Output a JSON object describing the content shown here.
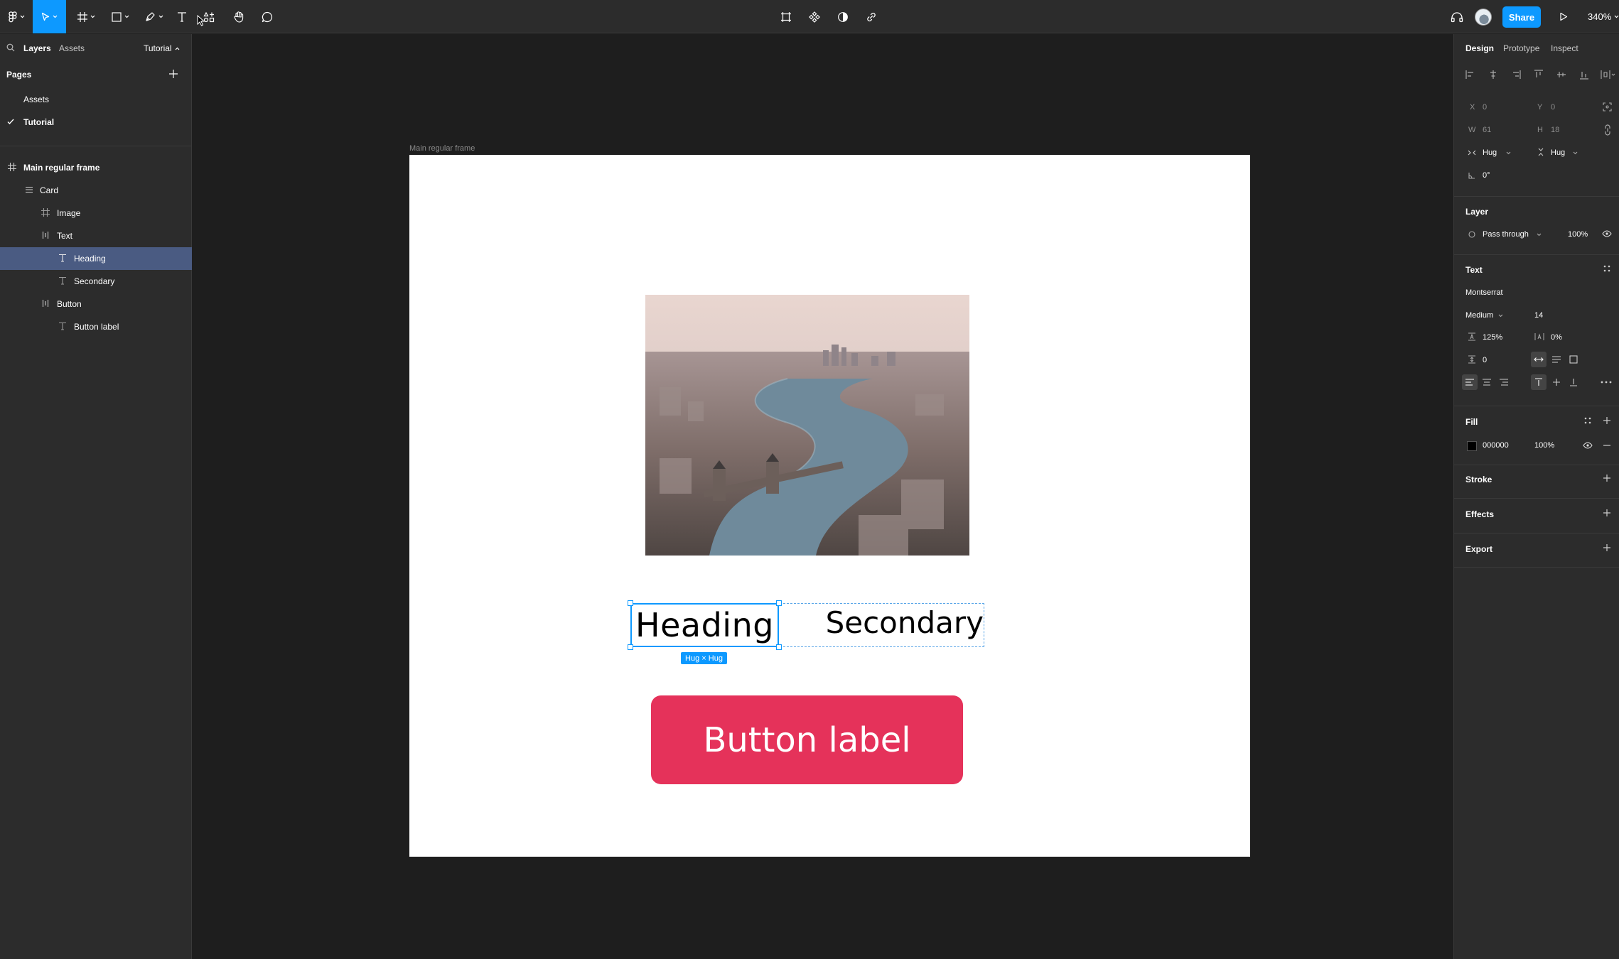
{
  "toolbar": {
    "share_label": "Share",
    "zoom": "340%",
    "icons": [
      "figma-menu-icon",
      "move-tool-icon",
      "frame-tool-icon",
      "shape-tool-icon",
      "pen-tool-icon",
      "text-tool-icon",
      "resources-icon",
      "hand-tool-icon",
      "comment-icon",
      "crop-icon",
      "component-icon",
      "contrast-icon",
      "link-icon",
      "headphones-icon",
      "play-icon"
    ]
  },
  "left_panel": {
    "tabs": {
      "layers": "Layers",
      "assets": "Assets"
    },
    "page_dropdown": "Tutorial",
    "pages_title": "Pages",
    "pages": [
      {
        "label": "Assets",
        "current": false
      },
      {
        "label": "Tutorial",
        "current": true
      }
    ],
    "layers": [
      {
        "label": "Main regular frame",
        "icon": "frame-icon",
        "depth": 0,
        "bold": true
      },
      {
        "label": "Card",
        "icon": "vertical-autolayout-icon",
        "depth": 1
      },
      {
        "label": "Image",
        "icon": "frame-icon",
        "depth": 2
      },
      {
        "label": "Text",
        "icon": "horizontal-autolayout-icon",
        "depth": 2
      },
      {
        "label": "Heading",
        "icon": "text-layer-icon",
        "depth": 3,
        "selected": true
      },
      {
        "label": "Secondary",
        "icon": "text-layer-icon",
        "depth": 3
      },
      {
        "label": "Button",
        "icon": "horizontal-autolayout-icon",
        "depth": 2
      },
      {
        "label": "Button label",
        "icon": "text-layer-icon",
        "depth": 3
      }
    ]
  },
  "canvas": {
    "frame_label": "Main regular frame",
    "heading": "Heading",
    "secondary": "Secondary",
    "hug_badge": "Hug × Hug",
    "button_label": "Button label",
    "button_color": "#e5325a",
    "selection_color": "#0d99ff"
  },
  "right_panel": {
    "tabs": {
      "design": "Design",
      "prototype": "Prototype",
      "inspect": "Inspect"
    },
    "position": {
      "x_label": "X",
      "x": "0",
      "y_label": "Y",
      "y": "0"
    },
    "size": {
      "w_label": "W",
      "w": "61",
      "h_label": "H",
      "h": "18"
    },
    "resizing": {
      "horizontal": "Hug",
      "vertical": "Hug"
    },
    "rotation": "0°",
    "layer": {
      "title": "Layer",
      "blend": "Pass through",
      "opacity": "100%"
    },
    "text": {
      "title": "Text",
      "font": "Montserrat",
      "weight": "Medium",
      "size": "14",
      "line_height": "125%",
      "letter_spacing": "0%",
      "paragraph_spacing": "0"
    },
    "fill": {
      "title": "Fill",
      "hex": "000000",
      "opacity": "100%"
    },
    "stroke_title": "Stroke",
    "effects_title": "Effects",
    "export_title": "Export"
  },
  "help": "?"
}
